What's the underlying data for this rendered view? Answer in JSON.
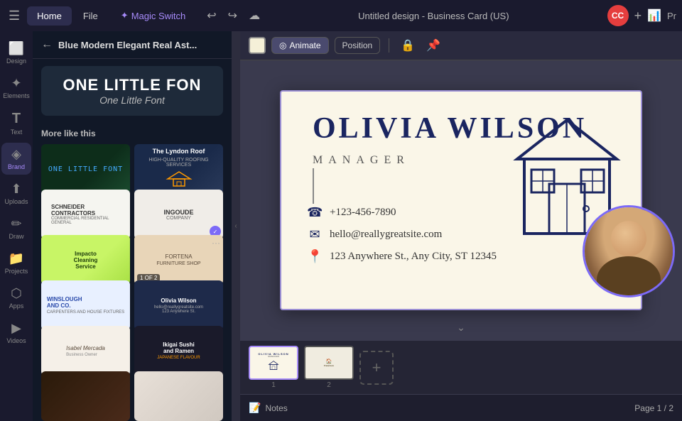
{
  "topbar": {
    "home_label": "Home",
    "file_label": "File",
    "magic_switch_label": "Magic Switch",
    "title": "Untitled design - Business Card (US)",
    "avatar": "CC",
    "pr_label": "Pr"
  },
  "toolbar": {
    "animate_label": "Animate",
    "position_label": "Position"
  },
  "panel": {
    "title": "Blue Modern Elegant Real Ast...",
    "font_line1": "ONE LITTLE FON",
    "font_line2": "One Little Font",
    "more_label": "More like this"
  },
  "templates": [
    {
      "id": "dark-green",
      "type": "dark-green",
      "text": ""
    },
    {
      "id": "roofing",
      "type": "roofing",
      "text": "The Lyndon Roof\nHIGH-QUALITY ROOFING SERVICES"
    },
    {
      "id": "contractors",
      "type": "contractors",
      "text": "SCHNEIDER CONTRACTORS"
    },
    {
      "id": "ingoude",
      "type": "ingoude",
      "text": "INGOUDE COMPANY"
    },
    {
      "id": "cleaning",
      "type": "cleaning",
      "text": "Impacto Cleaning Service"
    },
    {
      "id": "furniture",
      "type": "furniture",
      "text": "FORTENA FURNITURE SHOP",
      "badge": "1 OF 2"
    },
    {
      "id": "winslough",
      "type": "winslough",
      "text": "WINSLOUGH AND CO."
    },
    {
      "id": "olivia",
      "type": "olivia",
      "text": "Olivia Wilson"
    },
    {
      "id": "isabel",
      "type": "isabel",
      "text": "Isabel Mercada"
    },
    {
      "id": "ikigai",
      "type": "ikigai",
      "text": "Ikigai Sushi and Ramen"
    },
    {
      "id": "more1",
      "type": "more1",
      "text": ""
    },
    {
      "id": "more2",
      "type": "more2",
      "text": ""
    }
  ],
  "icons": {
    "sidebar": [
      {
        "id": "design",
        "sym": "⬜",
        "label": "Design"
      },
      {
        "id": "elements",
        "sym": "⭐",
        "label": "Elements"
      },
      {
        "id": "text",
        "sym": "T",
        "label": "Text"
      },
      {
        "id": "brand",
        "sym": "◈",
        "label": "Brand"
      },
      {
        "id": "uploads",
        "sym": "⬆",
        "label": "Uploads"
      },
      {
        "id": "draw",
        "sym": "✏",
        "label": "Draw"
      },
      {
        "id": "projects",
        "sym": "📁",
        "label": "Projects"
      },
      {
        "id": "apps",
        "sym": "⬡",
        "label": "Apps"
      },
      {
        "id": "videos",
        "sym": "▶",
        "label": "Videos"
      }
    ]
  },
  "canvas": {
    "person_name": "OLIVIA WILSON",
    "person_title": "MANAGER",
    "phone": "+123-456-7890",
    "email": "hello@reallygreatsite.com",
    "address": "123 Anywhere St., Any City, ST 12345"
  },
  "pages": [
    {
      "number": "1",
      "label": ""
    },
    {
      "number": "2",
      "label": ""
    }
  ],
  "notes_label": "Notes",
  "page_indicator": "Page 1 / 2"
}
